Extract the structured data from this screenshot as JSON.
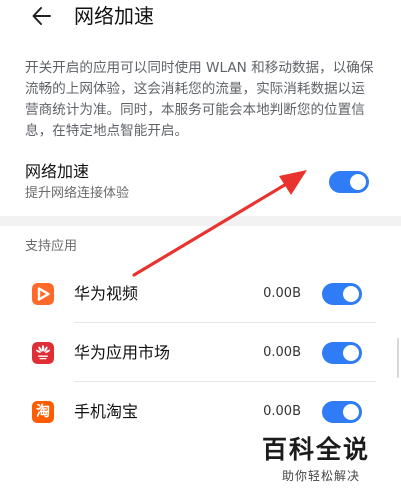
{
  "header": {
    "back_icon": "arrow-left-icon",
    "title": "网络加速"
  },
  "description": "开关开启的应用可以同时使用 WLAN 和移动数据，以确保流畅的上网体验，这会消耗您的流量，实际消耗数据以运营商统计为准。同时，本服务可能会本地判断您的位置信息，在特定地点智能开启。",
  "main_setting": {
    "title": "网络加速",
    "subtitle": "提升网络连接体验",
    "toggle_on": true
  },
  "section": {
    "header": "支持应用"
  },
  "apps": [
    {
      "name": "华为视频",
      "size": "0.00B",
      "icon": "huawei-video-icon",
      "toggle_on": true,
      "icon_color": "#ff6a2a"
    },
    {
      "name": "华为应用市场",
      "size": "0.00B",
      "icon": "huawei-appgallery-icon",
      "toggle_on": true,
      "icon_color": "#e02e36"
    },
    {
      "name": "手机淘宝",
      "size": "0.00B",
      "icon": "taobao-icon",
      "toggle_on": true,
      "icon_color": "#ff5b00",
      "icon_glyph": "淘"
    }
  ],
  "colors": {
    "accent": "#2f7cf6",
    "annotation_arrow": "#e8332e"
  },
  "watermark": {
    "logo": "百科全说",
    "subtitle": "助你轻松解决"
  }
}
